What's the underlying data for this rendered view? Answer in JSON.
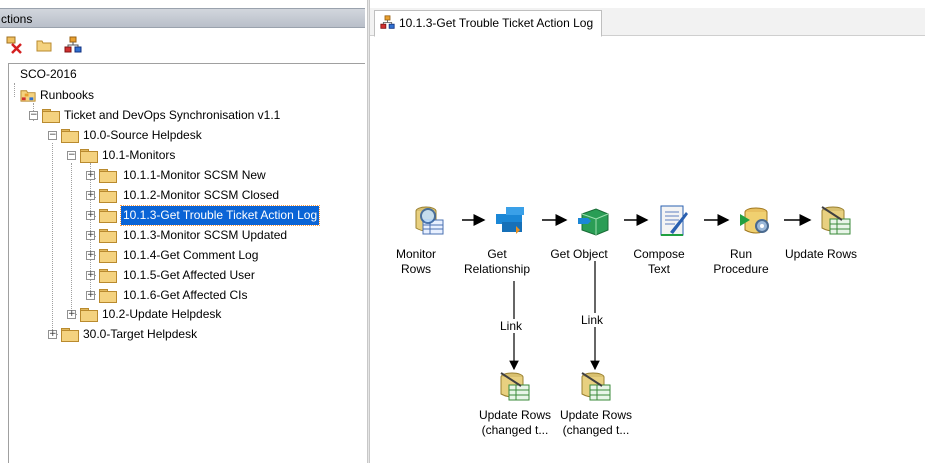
{
  "left_panel": {
    "header": "ctions",
    "toolbar": {
      "icons": [
        "delete-runbook-icon",
        "new-folder-icon",
        "runbook-icon"
      ]
    },
    "tree": [
      {
        "label": "SCO-2016",
        "level": 0,
        "type": "server"
      },
      {
        "label": "Runbooks",
        "level": 0,
        "type": "runbooks"
      },
      {
        "label": "Ticket and DevOps Synchronisation v1.1",
        "level": 1,
        "type": "folder",
        "expanded": true
      },
      {
        "label": "10.0-Source Helpdesk",
        "level": 2,
        "type": "folder",
        "expanded": true
      },
      {
        "label": "10.1-Monitors",
        "level": 3,
        "type": "folder",
        "expanded": true
      },
      {
        "label": "10.1.1-Monitor SCSM New",
        "level": 4,
        "type": "folder"
      },
      {
        "label": "10.1.2-Monitor SCSM Closed",
        "level": 4,
        "type": "folder"
      },
      {
        "label": "10.1.3-Get Trouble Ticket Action Log",
        "level": 4,
        "type": "folder",
        "selected": true
      },
      {
        "label": "10.1.3-Monitor SCSM Updated",
        "level": 4,
        "type": "folder"
      },
      {
        "label": "10.1.4-Get Comment Log",
        "level": 4,
        "type": "folder"
      },
      {
        "label": "10.1.5-Get Affected User",
        "level": 4,
        "type": "folder"
      },
      {
        "label": "10.1.6-Get Affected CIs",
        "level": 4,
        "type": "folder"
      },
      {
        "label": "10.2-Update Helpdesk",
        "level": 3,
        "type": "folder"
      },
      {
        "label": "30.0-Target Helpdesk",
        "level": 2,
        "type": "folder"
      }
    ]
  },
  "right_panel": {
    "tab_label": "10.1.3-Get Trouble Ticket Action Log",
    "activities": [
      {
        "id": "monitor",
        "label_lines": [
          "Monitor",
          "Rows"
        ],
        "icon": "monitor-rows-icon"
      },
      {
        "id": "getrel",
        "label_lines": [
          "Get",
          "Relationship"
        ],
        "icon": "get-relationship-icon"
      },
      {
        "id": "getobj",
        "label_lines": [
          "Get Object"
        ],
        "icon": "get-object-icon"
      },
      {
        "id": "compose",
        "label_lines": [
          "Compose",
          "Text"
        ],
        "icon": "compose-text-icon"
      },
      {
        "id": "runproc",
        "label_lines": [
          "Run",
          "Procedure"
        ],
        "icon": "run-procedure-icon"
      },
      {
        "id": "update",
        "label_lines": [
          "Update Rows"
        ],
        "icon": "update-rows-icon"
      },
      {
        "id": "update2",
        "label_lines": [
          "Update Rows",
          "(changed t..."
        ],
        "icon": "update-rows-icon"
      },
      {
        "id": "update3",
        "label_lines": [
          "Update Rows",
          "(changed t..."
        ],
        "icon": "update-rows-icon"
      }
    ],
    "links": [
      {
        "from": "getrel",
        "to": "update2",
        "label": "Link"
      },
      {
        "from": "getobj",
        "to": "update3",
        "label": "Link"
      }
    ]
  },
  "colors": {
    "selection": "#0a64d6",
    "header_gradient": "#c6cbd3",
    "folder": "#f4d27f"
  }
}
